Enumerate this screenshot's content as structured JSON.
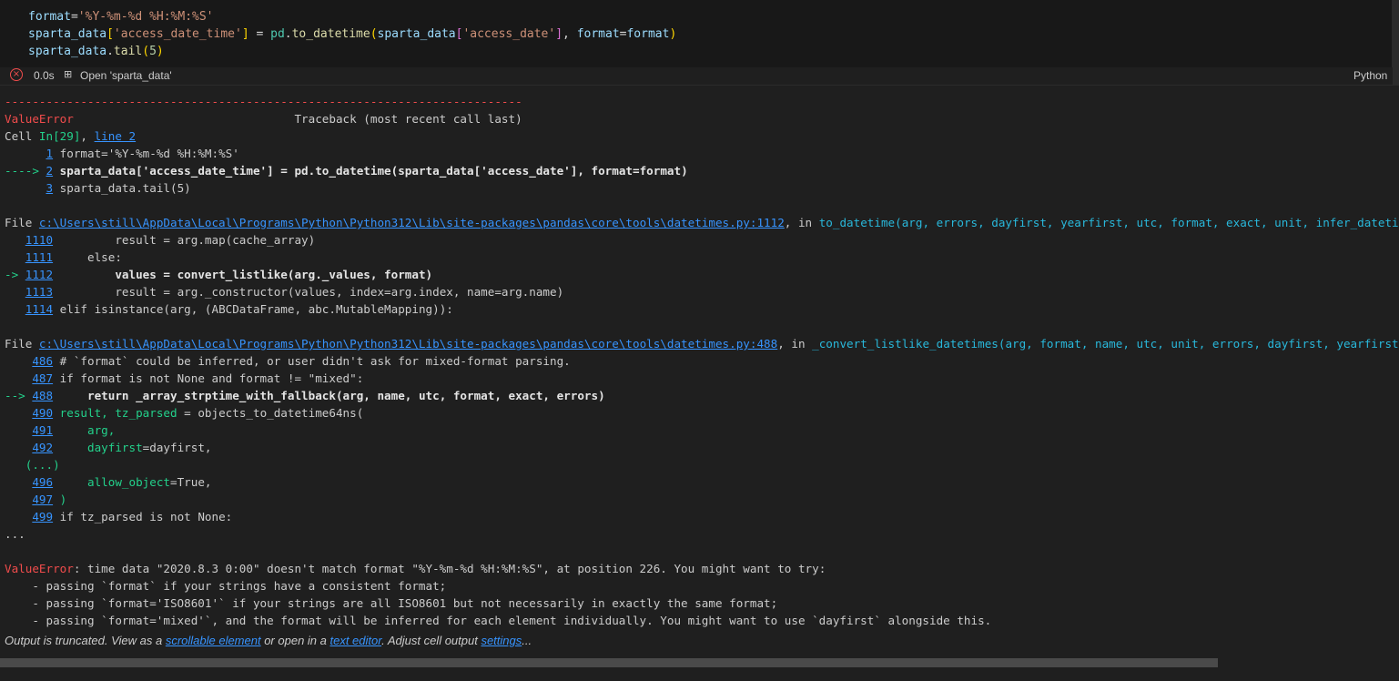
{
  "code": {
    "line1": {
      "var": "format",
      "op": "=",
      "str": "'%Y-%m-%d %H:%M:%S'"
    },
    "line2": {
      "var1": "sparta_data",
      "br1": "[",
      "str1": "'access_date_time'",
      "br2": "]",
      "op": " = ",
      "mod": "pd",
      "dot": ".",
      "fn": "to_datetime",
      "paren_open": "(",
      "var2": "sparta_data",
      "br3": "[",
      "str2": "'access_date'",
      "br4": "]",
      "comma": ", ",
      "kw": "format",
      "eq": "=",
      "var3": "format",
      "paren_close": ")"
    },
    "line3": {
      "var": "sparta_data",
      "dot": ".",
      "fn": "tail",
      "paren_open": "(",
      "num": "5",
      "paren_close": ")"
    }
  },
  "status": {
    "time": "0.0s",
    "open_label": "Open 'sparta_data'",
    "language": "Python"
  },
  "output": {
    "dashes": "---------------------------------------------------------------------------",
    "error_name": "ValueError",
    "traceback_header": "                                Traceback (most recent call last)",
    "cell_prefix": "Cell ",
    "cell_ref": "In[29]",
    "cell_sep": ", ",
    "cell_line_link": "line 2",
    "frame0": [
      {
        "arrow": "      ",
        "num": "1",
        "code": " format='%Y-%m-%d %H:%M:%S'"
      },
      {
        "arrow": "----> ",
        "num": "2",
        "code": " sparta_data['access_date_time'] = pd.to_datetime(sparta_data['access_date'], format=format)"
      },
      {
        "arrow": "      ",
        "num": "3",
        "code": " sparta_data.tail(5)"
      }
    ],
    "file1_prefix": "File ",
    "file1_path": "c:\\Users\\still\\AppData\\Local\\Programs\\Python\\Python312\\Lib\\site-packages\\pandas\\core\\tools\\datetimes.py:1112",
    "file1_in": ", in ",
    "file1_func": "to_datetime(arg, errors, dayfirst, yearfirst, utc, format, exact, unit, infer_datetime_format, origin, cache)",
    "frame1": [
      {
        "arrow": "   ",
        "num": "1110",
        "code": "         result = arg.map(cache_array)"
      },
      {
        "arrow": "   ",
        "num": "1111",
        "code": "     else:"
      },
      {
        "arrow": "-> ",
        "num": "1112",
        "code_pre": "         values = ",
        "code_bold": "convert_listlike(arg._values, format)"
      },
      {
        "arrow": "   ",
        "num": "1113",
        "code": "         result = arg._constructor(values, index=arg.index, name=arg.name)"
      },
      {
        "arrow": "   ",
        "num": "1114",
        "code": " elif isinstance(arg, (ABCDataFrame, abc.MutableMapping)):"
      }
    ],
    "file2_prefix": "File ",
    "file2_path": "c:\\Users\\still\\AppData\\Local\\Programs\\Python\\Python312\\Lib\\site-packages\\pandas\\core\\tools\\datetimes.py:488",
    "file2_in": ", in ",
    "file2_func": "_convert_listlike_datetimes(arg, format, name, utc, unit, errors, dayfirst, yearfirst, exact)",
    "frame2": [
      {
        "arrow": "    ",
        "num": "486",
        "code": " # `format` could be inferred, or user didn't ask for mixed-format parsing."
      },
      {
        "arrow": "    ",
        "num": "487",
        "code": " if format is not None and format != \"mixed\":"
      },
      {
        "arrow": "--> ",
        "num": "488",
        "code_bold": "     return _array_strptime_with_fallback(arg, name, utc, format, exact, errors)"
      },
      {
        "arrow": "    ",
        "num": "490",
        "code_green": " result, tz_parsed",
        "code_rest": " = objects_to_datetime64ns("
      },
      {
        "arrow": "    ",
        "num": "491",
        "code_green": "     arg,"
      },
      {
        "arrow": "    ",
        "num": "492",
        "code_green": "     dayfirst",
        "code_rest": "=dayfirst,"
      },
      {
        "arrow": "",
        "num": "",
        "code_green": "   (...)"
      },
      {
        "arrow": "    ",
        "num": "496",
        "code_green": "     allow_object",
        "code_rest": "=True,"
      },
      {
        "arrow": "    ",
        "num": "497",
        "code_green": " )"
      },
      {
        "arrow": "    ",
        "num": "499",
        "code": " if tz_parsed is not None:"
      }
    ],
    "ellipsis": "...",
    "final_error_name": "ValueError",
    "final_error_msg": ": time data \"2020.8.3 0:00\" doesn't match format \"%Y-%m-%d %H:%M:%S\", at position 226. You might want to try:",
    "hints": [
      "    - passing `format` if your strings have a consistent format;",
      "    - passing `format='ISO8601'` if your strings are all ISO8601 but not necessarily in exactly the same format;",
      "    - passing `format='mixed'`, and the format will be inferred for each element individually. You might want to use `dayfirst` alongside this."
    ]
  },
  "footer": {
    "text1": "Output is truncated. View as a ",
    "link1": "scrollable element",
    "text2": " or open in a ",
    "link2": "text editor",
    "text3": ". Adjust cell output ",
    "link3": "settings",
    "text4": "..."
  }
}
